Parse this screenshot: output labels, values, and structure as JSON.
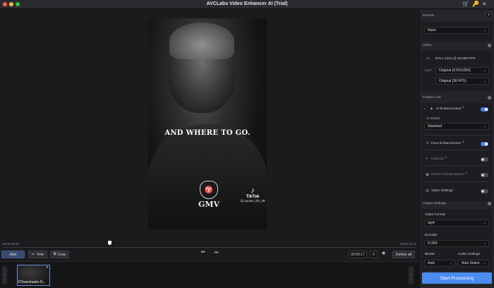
{
  "window": {
    "title": "AVCLabs Video Enhancer AI (Trial)",
    "colors": {
      "close": "#ff5f57",
      "minimize": "#febc2e",
      "maximize": "#28c840",
      "accent": "#4a8cf0"
    }
  },
  "titlebar_icons": {
    "cart": "🛒",
    "key": "🔑",
    "menu": "≡"
  },
  "preview": {
    "caption": "AND WHERE TO GO.",
    "watermark_gmv": "GMV",
    "tiktok_icon": "♪",
    "tiktok_name": "TikTok",
    "tiktok_user": "@ quotes_life_39"
  },
  "timeline": {
    "start_time": "00:00:00:00",
    "end_time": "00:00:12:11"
  },
  "toolbar": {
    "add": "Add",
    "trim_icon": "✂",
    "trim": "Trim",
    "crop_icon": "⧉",
    "crop": "Crop",
    "prev_icon": "⏮",
    "next_icon": "⏭",
    "time_field": "00:00:17",
    "frame_field": "0",
    "eye_icon": "◉",
    "delete_all": "Delete all"
  },
  "clip_strip": {
    "left_arrow": "‹",
    "right_arrow": "›",
    "clip_name": "FDownloader.N...",
    "clip_close": "✕"
  },
  "sidebar": {
    "presets": {
      "title": "Presets",
      "add_icon": "+",
      "value": "None"
    },
    "video": {
      "title": "Video",
      "in_label": "IN",
      "in_value": "576 x 1024 @ 30.000 FPS",
      "out_label": "OUT",
      "out_resolution": "Original (576X1024)",
      "out_fps": "Original (30 FPS)"
    },
    "feature_list": {
      "title": "Feature List",
      "ai_enhancement": {
        "label": "AI Enhancement",
        "sup": "AI",
        "enabled": true
      },
      "ai_model_label": "AI Model :",
      "ai_model_value": "Standard",
      "face_enhancement": {
        "label": "Face Enhancement",
        "sup": "AI",
        "enabled": true
      },
      "colorize": {
        "label": "Colorize",
        "sup": "AI",
        "enabled": false
      },
      "motion_compensation": {
        "label": "Motion Compensation",
        "sup": "AI",
        "enabled": false
      },
      "video_settings": {
        "label": "Video Settings",
        "enabled": false
      }
    },
    "output_settings": {
      "title": "Output Settings",
      "video_format_label": "Video Format",
      "video_format_value": "mp4",
      "encoder_label": "Encoder",
      "encoder_value": "H.264",
      "bitrate_label": "Bitrate",
      "bitrate_value": "Auto",
      "audio_settings_label": "Audio Settings",
      "audio_settings_value": "Auto Select"
    },
    "start_processing": "Start Processing"
  }
}
